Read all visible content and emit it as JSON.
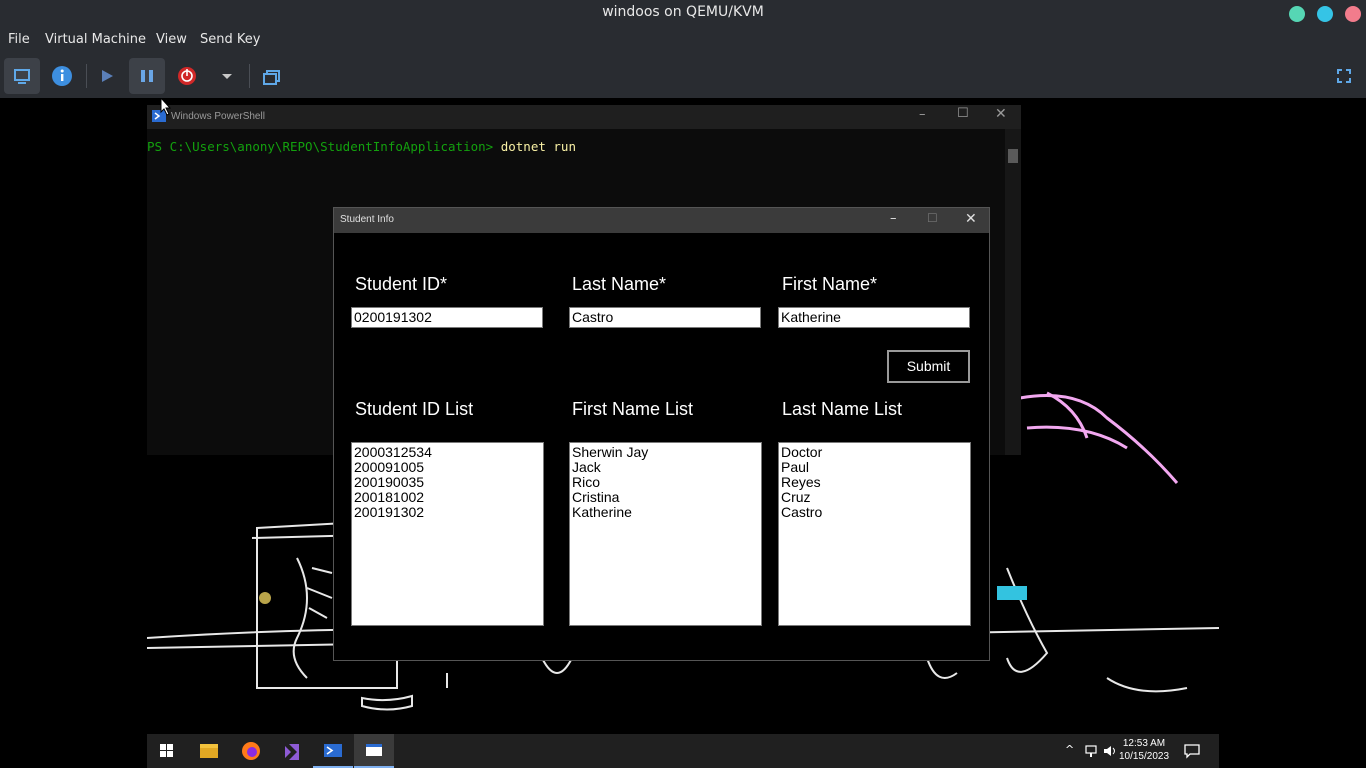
{
  "host": {
    "title": "windoos on QEMU/KVM",
    "window_controls": [
      {
        "name": "minimize",
        "color": "#56d6b4"
      },
      {
        "name": "maximize",
        "color": "#35c4e6"
      },
      {
        "name": "close",
        "color": "#f27c8c"
      }
    ],
    "menu": [
      "File",
      "Virtual Machine",
      "View",
      "Send Key"
    ],
    "toolbar": {
      "buttons": [
        "console-icon",
        "details-info-icon",
        "run-icon",
        "pause-icon",
        "shutdown-icon",
        "shutdown-menu-chevron-icon",
        "snapshots-icon",
        "fullscreen-icon"
      ]
    }
  },
  "guest": {
    "powershell": {
      "title": "Windows PowerShell",
      "prompt": "PS C:\\Users\\anony\\REPO\\StudentInfoApplication> ",
      "command": "dotnet run"
    },
    "student_info": {
      "title": "Student Info",
      "labels": {
        "student_id": "Student ID*",
        "last_name": "Last Name*",
        "first_name": "First Name*",
        "student_id_list": "Student ID List",
        "first_name_list": "First Name List",
        "last_name_list": "Last Name List"
      },
      "inputs": {
        "student_id": "0200191302",
        "last_name": "Castro",
        "first_name": "Katherine"
      },
      "submit_label": "Submit",
      "lists": {
        "student_ids": [
          "2000312534",
          "200091005",
          "200190035",
          "200181002",
          "200191302"
        ],
        "first_names": [
          "Sherwin Jay",
          "Jack",
          "Rico",
          "Cristina",
          "Katherine"
        ],
        "last_names": [
          "Doctor",
          "Paul",
          "Reyes",
          "Cruz",
          "Castro"
        ]
      }
    },
    "taskbar": {
      "items": [
        "windows-start-icon",
        "file-explorer-icon",
        "firefox-icon",
        "visual-studio-icon",
        "powershell-taskbar-icon",
        "student-info-taskbar-icon"
      ],
      "time": "12:53 AM",
      "date": "10/15/2023"
    },
    "colors": {
      "host_chrome": "#292c31",
      "ps_prompt": "#13a10e",
      "ps_command": "#f9f1a5",
      "wallpaper_accent": "#f2a8f0"
    }
  }
}
